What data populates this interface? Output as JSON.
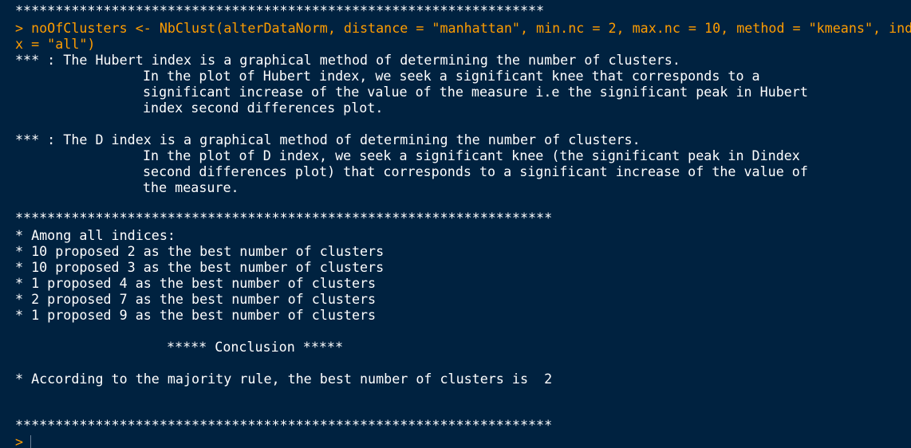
{
  "console": {
    "stars_top": "******************************************************************",
    "cmd_line1": "> noOfClusters <- NbClust(alterDataNorm, distance = \"manhattan\", min.nc = 2, max.nc = 10, method = \"kmeans\", index = \"all\")",
    "cmd_line2": "x = \"all\")",
    "hubert_line1": "*** : The Hubert index is a graphical method of determining the number of clusters.",
    "hubert_line2": "In the plot of Hubert index, we seek a significant knee that corresponds to a",
    "hubert_line3": "significant increase of the value of the measure i.e the significant peak in Hubert",
    "hubert_line4": "index second differences plot.",
    "dindex_line1": "*** : The D index is a graphical method of determining the number of clusters.",
    "dindex_line2": "In the plot of D index, we seek a significant knee (the significant peak in Dindex",
    "dindex_line3": "second differences plot) that corresponds to a significant increase of the value of",
    "dindex_line4": "the measure.",
    "stars_mid": "*******************************************************************",
    "summary": {
      "heading": "* Among all indices:",
      "items": [
        "* 10 proposed 2 as the best number of clusters",
        "* 10 proposed 3 as the best number of clusters",
        "* 1 proposed 4 as the best number of clusters",
        "* 2 proposed 7 as the best number of clusters",
        "* 1 proposed 9 as the best number of clusters"
      ]
    },
    "conclusion_heading": "***** Conclusion *****",
    "conclusion_text": "* According to the majority rule, the best number of clusters is  2",
    "stars_bottom": "*******************************************************************",
    "prompt": ">"
  },
  "colors": {
    "background": "#002240",
    "text": "#ffffff",
    "command": "#ff9d00"
  }
}
